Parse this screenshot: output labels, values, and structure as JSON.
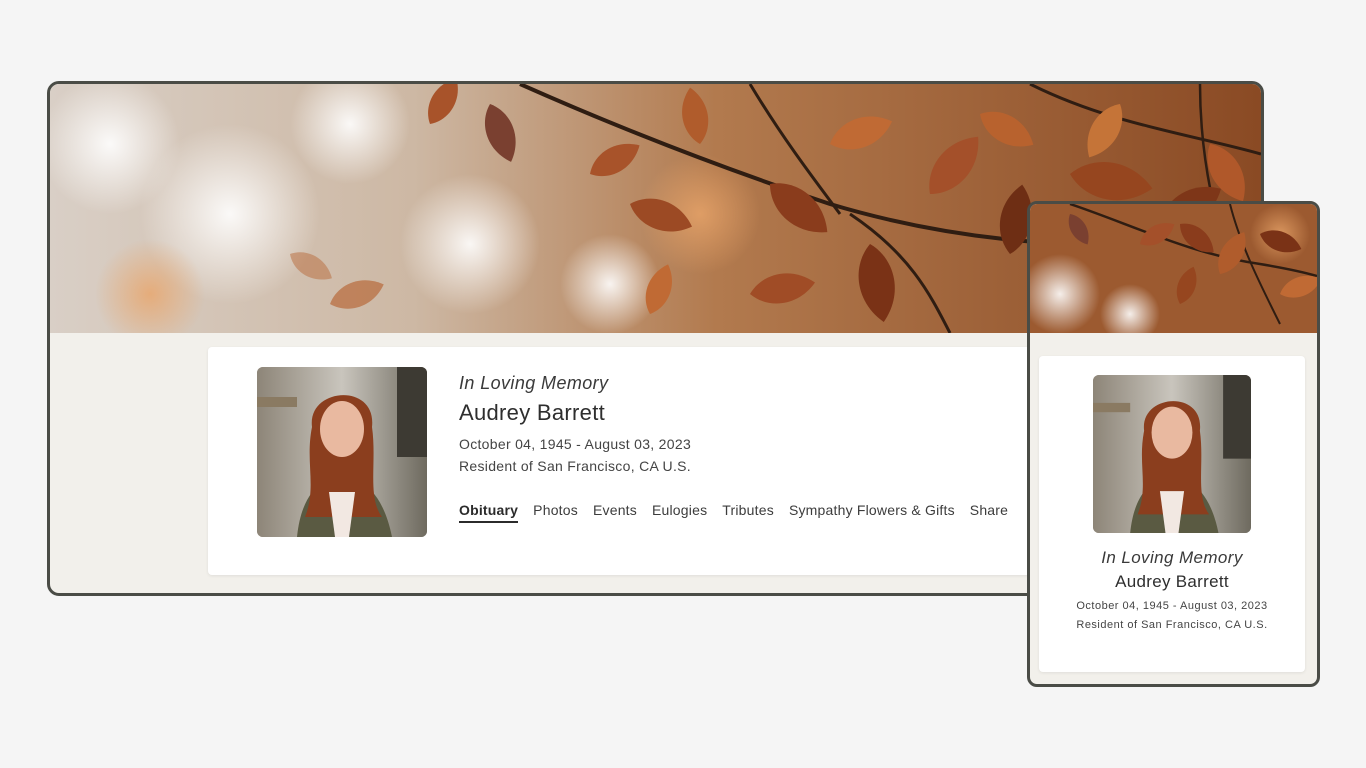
{
  "memorial": {
    "tagline": "In Loving Memory",
    "name": "Audrey Barrett",
    "dates": "October 04, 1945 - August 03, 2023",
    "residence": "Resident of San Francisco, CA U.S."
  },
  "tabs": [
    {
      "label": "Obituary",
      "active": true
    },
    {
      "label": "Photos",
      "active": false
    },
    {
      "label": "Events",
      "active": false
    },
    {
      "label": "Eulogies",
      "active": false
    },
    {
      "label": "Tributes",
      "active": false
    },
    {
      "label": "Sympathy Flowers & Gifts",
      "active": false
    },
    {
      "label": "Share",
      "active": false
    }
  ],
  "colors": {
    "page_bg": "#f5f5f5",
    "frame_border": "#4a4c46",
    "content_bg": "#f2f0eb",
    "card_bg": "#ffffff",
    "leaf_orange": "#b0582a",
    "leaf_dark": "#7a3216"
  },
  "images": {
    "banner": "autumn-leaves-photo",
    "portrait": "portrait-photo"
  }
}
